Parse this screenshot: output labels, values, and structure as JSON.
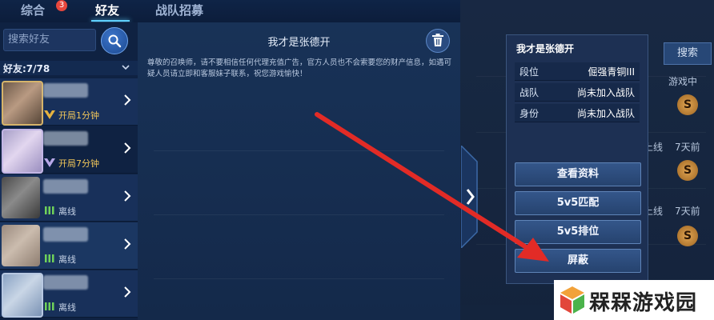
{
  "tabs": [
    {
      "label": "综合",
      "badge": "3"
    },
    {
      "label": "好友"
    },
    {
      "label": "战队招募"
    }
  ],
  "sidebar": {
    "search_placeholder": "搜索好友",
    "friend_count": "好友:7/78",
    "friends": [
      {
        "status": "开局1分钟",
        "state": "online"
      },
      {
        "status": "开局7分钟",
        "state": "online"
      },
      {
        "status": "离线",
        "state": "offline"
      },
      {
        "status": "离线",
        "state": "offline"
      },
      {
        "status": "离线",
        "state": "offline"
      }
    ]
  },
  "chat": {
    "title": "我才是张德开",
    "notice": "尊敬的召唤师，请不要相信任何代理充值广告，官方人员也不会索要您的财产信息，如遇可疑人员请立即和客服妹子联系，祝您游戏愉快！"
  },
  "profile": {
    "name": "我才是张德开",
    "rows": [
      {
        "label": "段位",
        "value": "倔强青铜III"
      },
      {
        "label": "战队",
        "value": "尚未加入战队"
      },
      {
        "label": "身份",
        "value": "尚未加入战队"
      }
    ],
    "buttons": {
      "view": "查看资料",
      "match": "5v5匹配",
      "ranked": "5v5排位",
      "block": "屏蔽"
    }
  },
  "background": {
    "search": "搜索",
    "in_game": "游戏中",
    "last_online": "最近上线",
    "seven_days_ago": "7天前",
    "badge_letter": "S"
  },
  "watermark": {
    "text": "槑槑游戏园"
  },
  "colors": {
    "accent": "#5fd0ff",
    "arrow": "#e22b26",
    "online": "#f2c75a"
  }
}
